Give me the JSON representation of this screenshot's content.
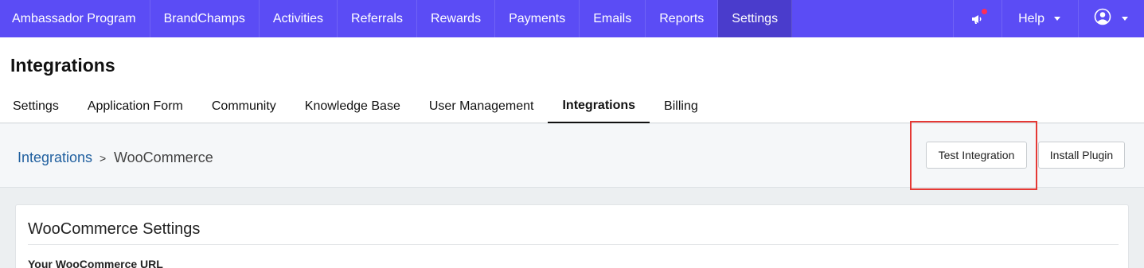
{
  "topnav": {
    "items": [
      {
        "label": "Ambassador Program"
      },
      {
        "label": "BrandChamps"
      },
      {
        "label": "Activities"
      },
      {
        "label": "Referrals"
      },
      {
        "label": "Rewards"
      },
      {
        "label": "Payments"
      },
      {
        "label": "Emails"
      },
      {
        "label": "Reports"
      },
      {
        "label": "Settings",
        "active": true
      }
    ],
    "help_label": "Help",
    "notification_icon": "megaphone-icon",
    "user_icon": "user-circle-icon",
    "colors": {
      "bar": "#5b4cf5",
      "active": "#4a3ccc",
      "badge": "#ff2d55"
    }
  },
  "header": {
    "title": "Integrations",
    "tabs": [
      {
        "label": "Settings"
      },
      {
        "label": "Application Form"
      },
      {
        "label": "Community"
      },
      {
        "label": "Knowledge Base"
      },
      {
        "label": "User Management"
      },
      {
        "label": "Integrations",
        "active": true
      },
      {
        "label": "Billing"
      }
    ]
  },
  "breadcrumb": {
    "parent": "Integrations",
    "separator": ">",
    "current": "WooCommerce"
  },
  "actions": {
    "test_label": "Test Integration",
    "install_label": "Install Plugin",
    "highlight_color": "#e53935"
  },
  "card": {
    "title": "WooCommerce Settings",
    "field_label": "Your WooCommerce URL"
  }
}
